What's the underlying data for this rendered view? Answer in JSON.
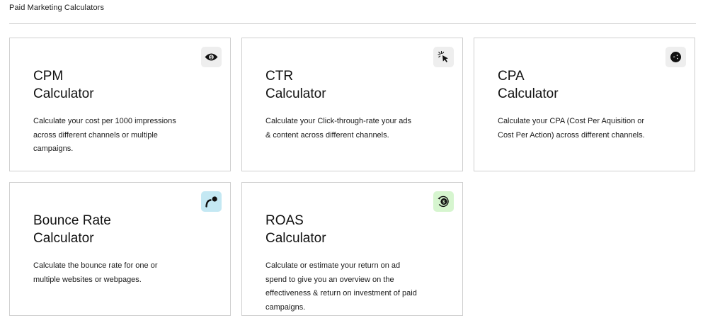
{
  "section": {
    "title": "Paid Marketing Calculators"
  },
  "cards": [
    {
      "title": "CPM\nCalculator",
      "description": "Calculate your cost per 1000 impressions across different channels or multiple campaigns.",
      "icon": "eye-dollar-icon",
      "icon_bg": "#eeeeee"
    },
    {
      "title": "CTR\nCalculator",
      "description": "Calculate your Click-through-rate your ads & content across different channels.",
      "icon": "cursor-click-icon",
      "icon_bg": "#eeeeee"
    },
    {
      "title": "CPA\nCalculator",
      "description": "Calculate your CPA (Cost Per Aquisition or Cost Per Action) across different channels.",
      "icon": "target-cost-icon",
      "icon_bg": "#eeeeee"
    },
    {
      "title": "Bounce Rate\nCalculator",
      "description": "Calculate the bounce rate for one or multiple websites or webpages.",
      "icon": "bounce-icon",
      "icon_bg": "#c4e8f3"
    },
    {
      "title": "ROAS\nCalculator",
      "description": "Calculate or estimate your return on ad spend to give you an overview on the effectiveness & return on investment of paid campaigns.",
      "icon": "return-dollar-icon",
      "icon_bg": "#d6f5cf"
    }
  ]
}
